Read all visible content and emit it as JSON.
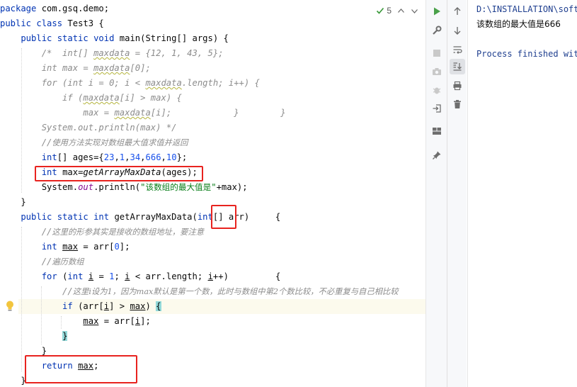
{
  "editor": {
    "inspection_count": "5",
    "lines": [
      [
        [
          "package ",
          "kw"
        ],
        [
          "com.gsq.demo;",
          ""
        ]
      ],
      [
        [
          "public class ",
          "kw"
        ],
        [
          "Test3 {",
          ""
        ]
      ],
      [
        [
          "    public static void ",
          "kw"
        ],
        [
          "main(String[] args) {",
          ""
        ]
      ],
      [
        [
          "        /*  int[] ",
          "cmt"
        ],
        [
          "maxdata",
          "cmt wavy"
        ],
        [
          " = {12, 1, 43, 5};",
          "cmt"
        ]
      ],
      [
        [
          "        int max = ",
          "cmt"
        ],
        [
          "maxdata",
          "cmt wavy"
        ],
        [
          "[0];",
          "cmt"
        ]
      ],
      [
        [
          "        for (int i = 0; i < ",
          "cmt"
        ],
        [
          "maxdata",
          "cmt wavy"
        ],
        [
          ".length; i++) {",
          "cmt"
        ]
      ],
      [
        [
          "            if (",
          "cmt"
        ],
        [
          "maxdata",
          "cmt wavy"
        ],
        [
          "[i] > max) {",
          "cmt"
        ]
      ],
      [
        [
          "                max = ",
          "cmt"
        ],
        [
          "maxdata",
          "cmt wavy"
        ],
        [
          "[i];            }        }",
          "cmt"
        ]
      ],
      [
        [
          "        System.out.println(max) */",
          "cmt"
        ]
      ],
      [
        [
          "        //",
          "cmt"
        ],
        [
          "使用方法实现对数组最大值求值并返回",
          "cmtcn"
        ]
      ],
      [
        [
          "        int",
          "kw"
        ],
        [
          "[] ages={",
          ""
        ],
        [
          "23",
          "num"
        ],
        [
          ",",
          ""
        ],
        [
          "1",
          "num"
        ],
        [
          ",",
          ""
        ],
        [
          "34",
          "num"
        ],
        [
          ",",
          ""
        ],
        [
          "666",
          "num"
        ],
        [
          ",",
          ""
        ],
        [
          "10",
          "num"
        ],
        [
          "};",
          ""
        ]
      ],
      [
        [
          "        int ",
          "kw"
        ],
        [
          "max=",
          ""
        ],
        [
          "getArrayMaxData",
          "mcall"
        ],
        [
          "(ages);",
          ""
        ]
      ],
      [
        [
          "        System.",
          ""
        ],
        [
          "out",
          "fld"
        ],
        [
          ".println(",
          ""
        ],
        [
          "\"",
          "str"
        ],
        [
          "该数组的最大值是",
          "str strcn"
        ],
        [
          "\"",
          "str"
        ],
        [
          "+max);",
          ""
        ]
      ],
      [
        [
          "    }",
          ""
        ]
      ],
      [
        [
          "    public static int ",
          "kw"
        ],
        [
          "getArrayMaxData(",
          ""
        ],
        [
          "int",
          "kw"
        ],
        [
          "[] arr)     {",
          ""
        ]
      ],
      [
        [
          "        //",
          "cmt"
        ],
        [
          "这里的形参其实是接收的数组地址，要注意",
          "cmtcn"
        ]
      ],
      [
        [
          "        int ",
          "kw"
        ],
        [
          "max",
          "uline"
        ],
        [
          " = arr[",
          ""
        ],
        [
          "0",
          "num"
        ],
        [
          "];",
          ""
        ]
      ],
      [
        [
          "        //",
          "cmt"
        ],
        [
          "遍历数组",
          "cmtcn"
        ]
      ],
      [
        [
          "        for ",
          "kw"
        ],
        [
          "(",
          ""
        ],
        [
          "int ",
          "kw"
        ],
        [
          "i",
          "uline"
        ],
        [
          " = ",
          ""
        ],
        [
          "1",
          "num"
        ],
        [
          "; ",
          ""
        ],
        [
          "i",
          "uline"
        ],
        [
          " < arr.length; ",
          ""
        ],
        [
          "i",
          "uline"
        ],
        [
          "++)         {",
          ""
        ]
      ],
      [
        [
          "            //",
          "cmt"
        ],
        [
          "这里i设为1，因为max默认是第一个数，此时与数组中第2个数比较，不必重复与自己相比较",
          "cmtcn"
        ]
      ],
      [
        [
          "            if ",
          "kw"
        ],
        [
          "(arr[",
          ""
        ],
        [
          "i",
          "uline"
        ],
        [
          "] > ",
          ""
        ],
        [
          "max",
          "uline"
        ],
        [
          ") ",
          ""
        ],
        [
          "{",
          "brace-hl"
        ]
      ],
      [
        [
          "                ",
          ""
        ],
        [
          "max",
          "uline"
        ],
        [
          " = arr[",
          ""
        ],
        [
          "i",
          "uline"
        ],
        [
          "];",
          ""
        ]
      ],
      [
        [
          "            ",
          ""
        ],
        [
          "}",
          "brace-hl"
        ]
      ],
      [
        [
          "        }",
          ""
        ]
      ],
      [
        [
          "        return ",
          "kw"
        ],
        [
          "max",
          "uline"
        ],
        [
          ";",
          ""
        ]
      ],
      [
        [
          "    }",
          ""
        ]
      ]
    ]
  },
  "console": {
    "path_line": "D:\\INSTALLATION\\softw",
    "output_line": "该数组的最大值是666",
    "finish_line": "Process finished with"
  }
}
